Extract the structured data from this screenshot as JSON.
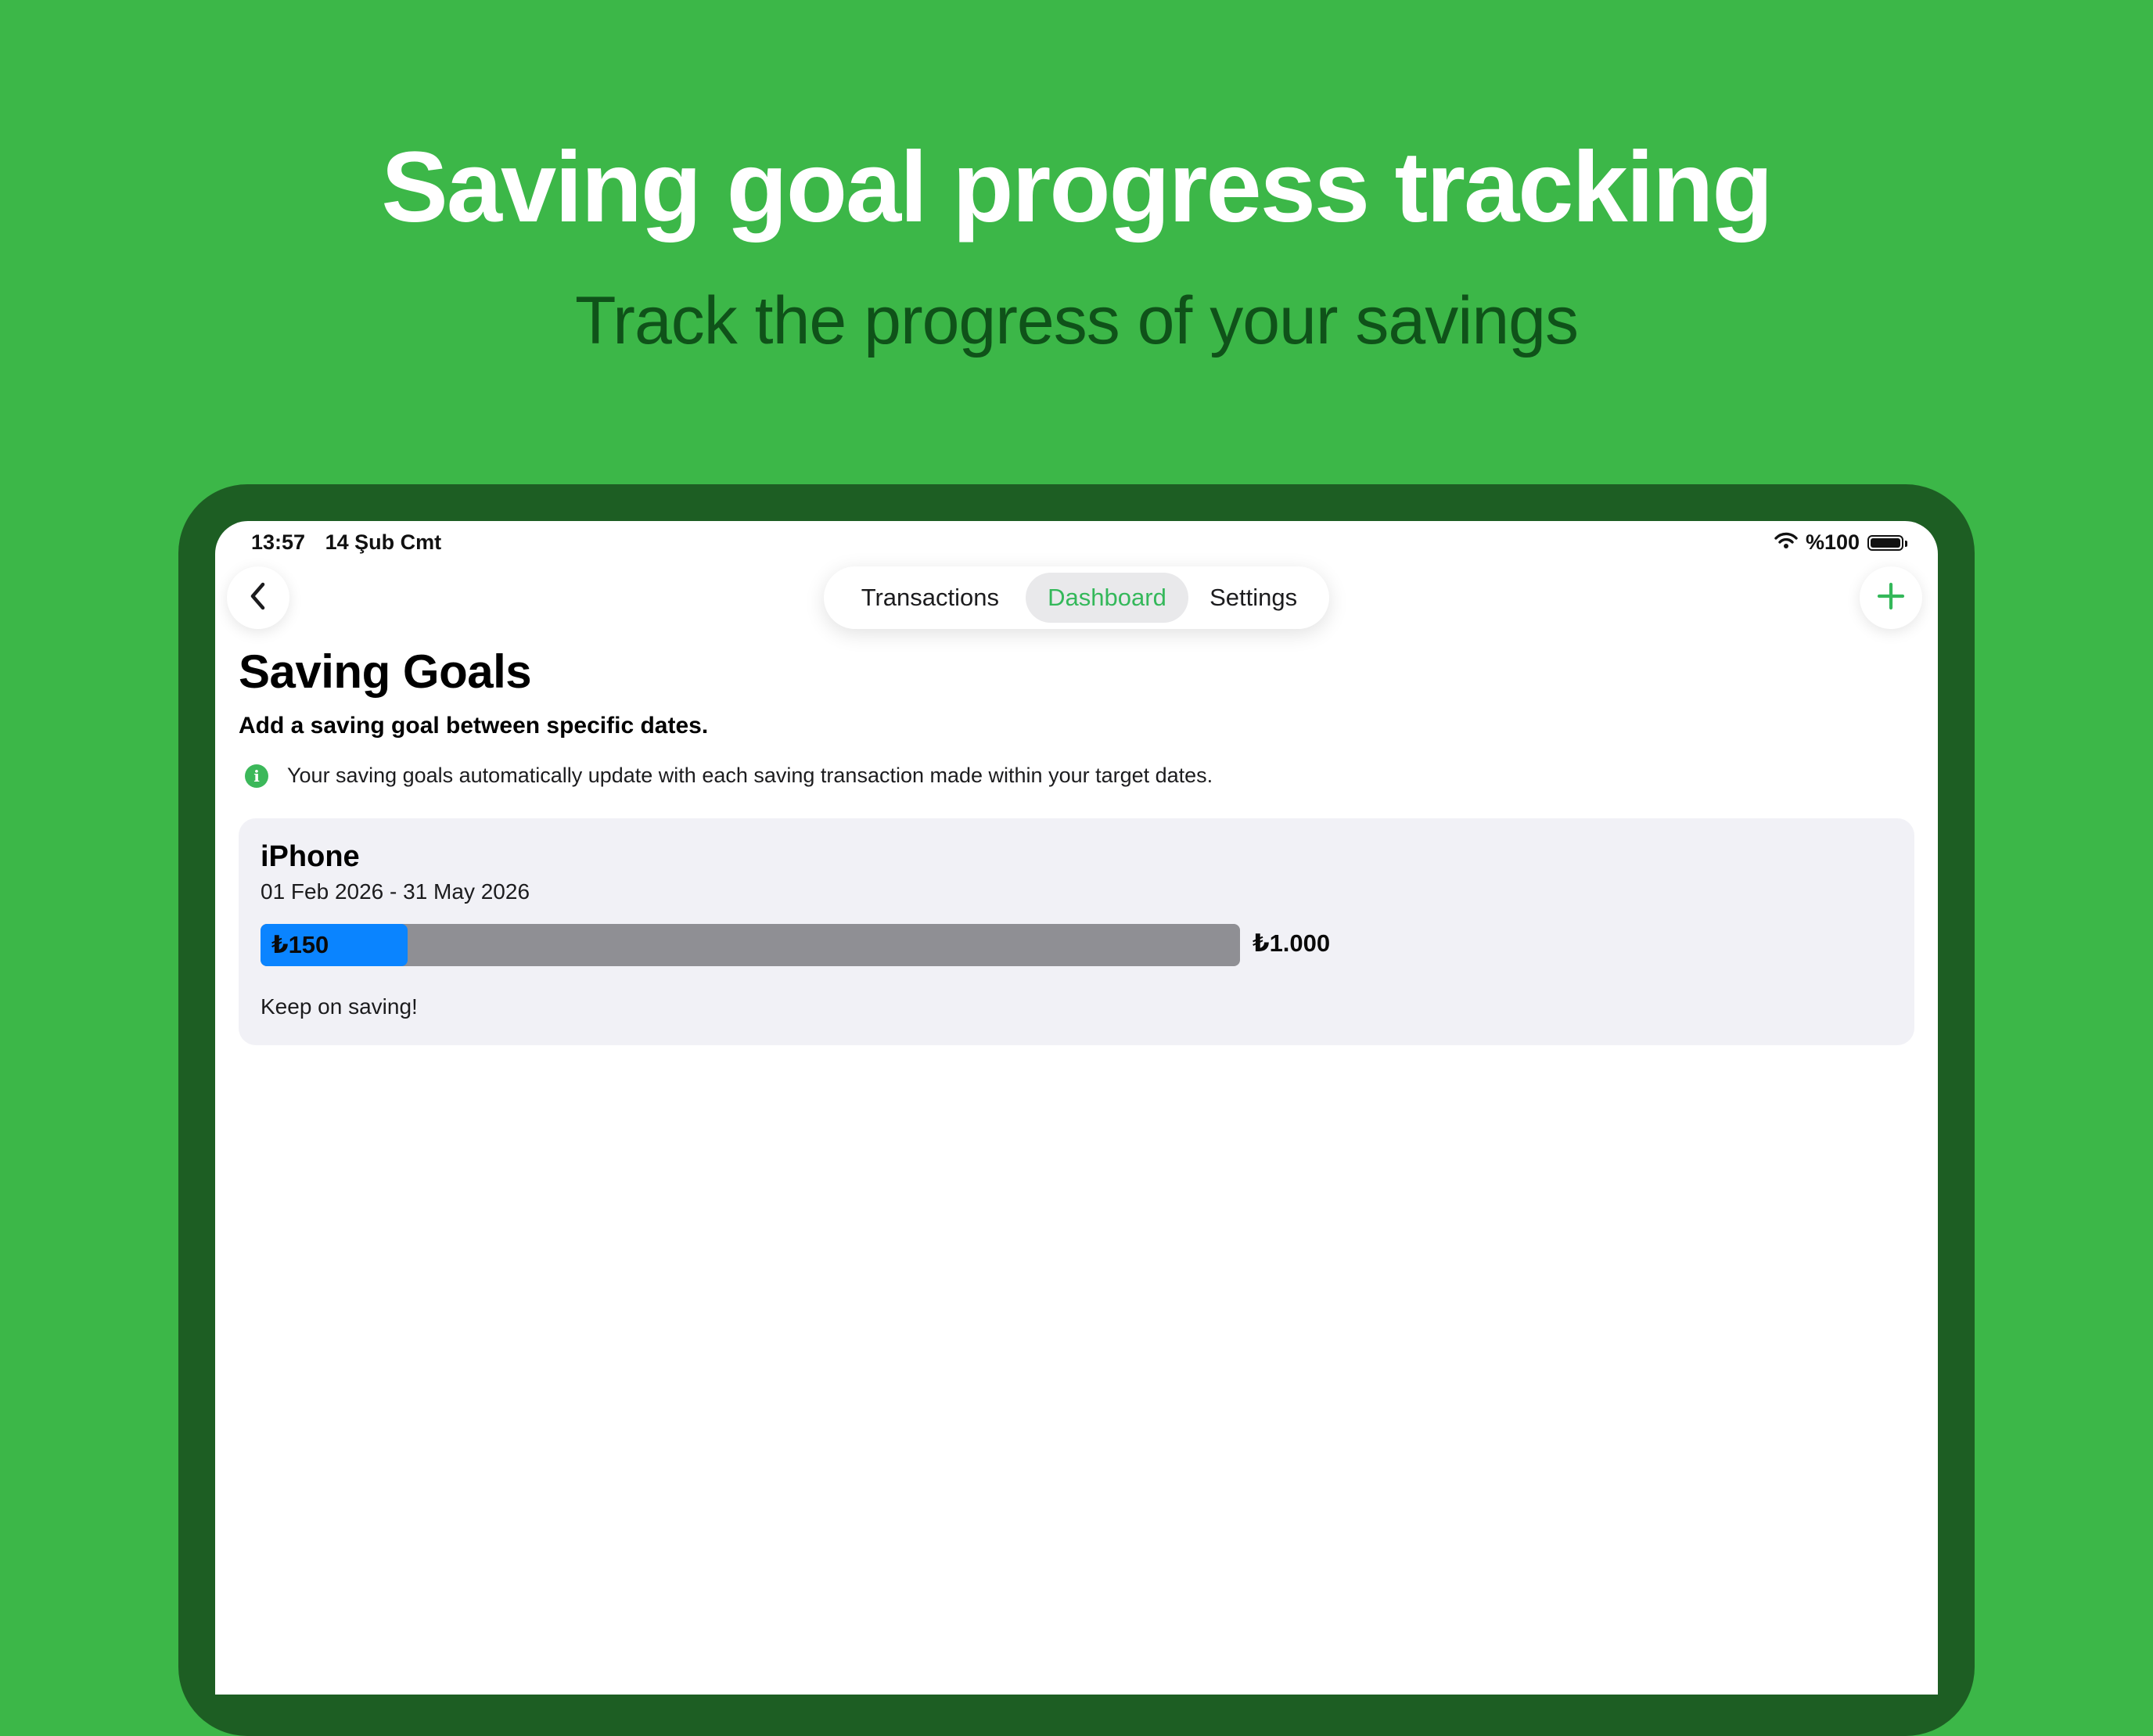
{
  "banner": {
    "headline": "Saving goal progress tracking",
    "subheadline": "Track the progress of your savings"
  },
  "status_bar": {
    "time": "13:57",
    "date": "14 Şub Cmt",
    "battery": "%100",
    "icons": [
      "wifi-icon",
      "battery-icon"
    ]
  },
  "nav": {
    "back_icon": "chevron-left-icon",
    "add_icon": "plus-icon",
    "tabs": [
      {
        "label": "Transactions",
        "selected": false
      },
      {
        "label": "Dashboard",
        "selected": true
      },
      {
        "label": "Settings",
        "selected": false
      }
    ]
  },
  "page": {
    "title": "Saving Goals",
    "subtitle": "Add a saving goal between specific dates.",
    "info_icon": "info-icon",
    "info_text": "Your saving goals automatically update with each saving transaction made within your target dates."
  },
  "goals": [
    {
      "name": "iPhone",
      "dates": "01 Feb 2026 - 31 May 2026",
      "current_label": "₺150",
      "target_label": "₺1.000",
      "progress": 0.15,
      "message": "Keep on saving!"
    }
  ],
  "colors": {
    "background": "#3cb748",
    "device_frame": "#1d5e23",
    "subheadline": "#0f5219",
    "accent": "#34b85a",
    "progress_fill": "#0a84ff",
    "progress_track": "#8f8f94",
    "card": "#f1f1f6"
  }
}
